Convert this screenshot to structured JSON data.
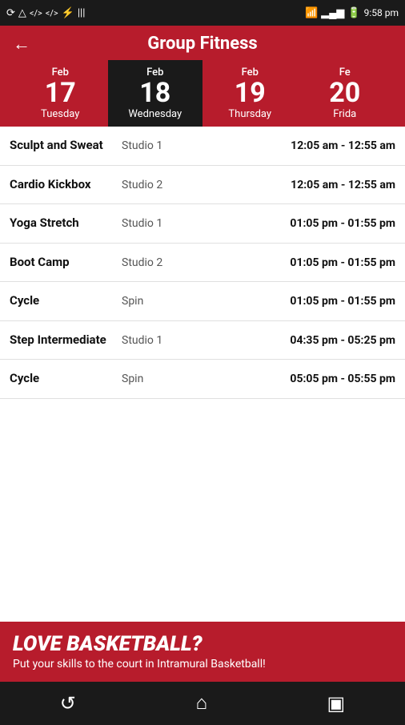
{
  "statusBar": {
    "time": "9:58 pm",
    "icons_left": [
      "⟳",
      "△",
      "</>",
      "</>",
      "USB",
      "|||"
    ],
    "icons_right": [
      "WiFi",
      "Signal",
      "Battery"
    ]
  },
  "header": {
    "title": "Group Fitness",
    "back_label": "←"
  },
  "dates": [
    {
      "month": "Feb",
      "day": "17",
      "weekday": "Tuesday",
      "active": false,
      "id": "feb17"
    },
    {
      "month": "Feb",
      "day": "18",
      "weekday": "Wednesday",
      "active": true,
      "id": "feb18"
    },
    {
      "month": "Feb",
      "day": "19",
      "weekday": "Thursday",
      "active": false,
      "id": "feb19"
    },
    {
      "month": "Fe",
      "day": "20",
      "weekday": "Frida",
      "active": false,
      "id": "feb20"
    }
  ],
  "classes": [
    {
      "name": "Sculpt and Sweat",
      "location": "Studio 1",
      "time": "12:05 am - 12:55 am"
    },
    {
      "name": "Cardio Kickbox",
      "location": "Studio 2",
      "time": "12:05 am - 12:55 am"
    },
    {
      "name": "Yoga Stretch",
      "location": "Studio 1",
      "time": "01:05 pm - 01:55 pm"
    },
    {
      "name": "Boot Camp",
      "location": "Studio 2",
      "time": "01:05 pm - 01:55 pm"
    },
    {
      "name": "Cycle",
      "location": "Spin",
      "time": "01:05 pm - 01:55 pm"
    },
    {
      "name": "Step Intermediate",
      "location": "Studio 1",
      "time": "04:35 pm - 05:25 pm"
    },
    {
      "name": "Cycle",
      "location": "Spin",
      "time": "05:05 pm - 05:55 pm"
    }
  ],
  "banner": {
    "title": "LOVE BASKETBALL?",
    "subtitle": "Put your skills to the court in Intramural Basketball!"
  },
  "bottomNav": {
    "back": "↺",
    "home": "⌂",
    "recent": "▣"
  }
}
